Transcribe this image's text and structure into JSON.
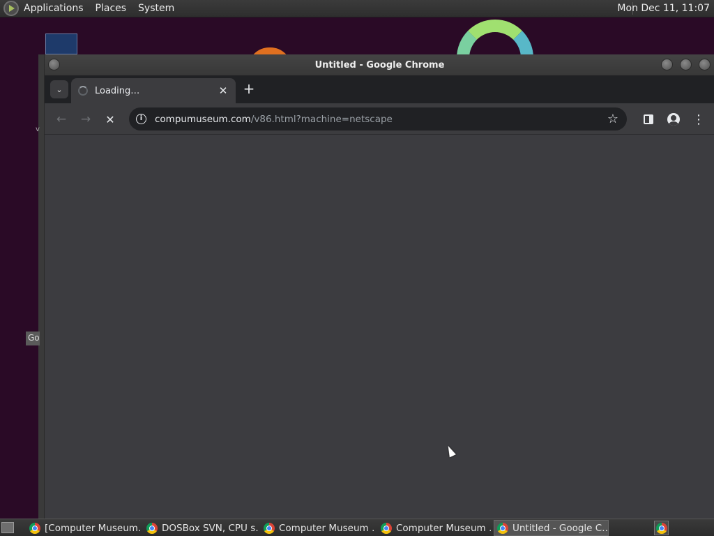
{
  "top_panel": {
    "menus": [
      "Applications",
      "Places",
      "System"
    ],
    "clock": "Mon Dec 11, 11:07"
  },
  "desktop": {
    "partial_label_v": "v",
    "partial_label_go": "Go"
  },
  "window": {
    "title": "Untitled - Google Chrome"
  },
  "tabs": [
    {
      "title": "Loading…",
      "state": "loading"
    }
  ],
  "toolbar": {
    "url_host": "compumuseum.com",
    "url_path": "/v86.html?machine=netscape",
    "back_icon": "arrow-left-icon",
    "forward_icon": "arrow-right-icon",
    "stop_icon": "close-icon"
  },
  "taskbar": {
    "items": [
      {
        "label": "[Computer Museum…",
        "active": false
      },
      {
        "label": "DOSBox SVN, CPU s…",
        "active": false
      },
      {
        "label": "Computer Museum …",
        "active": false
      },
      {
        "label": "Computer Museum …",
        "active": false
      },
      {
        "label": "Untitled - Google C…",
        "active": true
      }
    ]
  },
  "colors": {
    "desktop_bg": "#2a0a26",
    "chrome_toolbar": "#3c3c3f",
    "chrome_tabstrip": "#202124",
    "viewport": "#3c3c40"
  }
}
